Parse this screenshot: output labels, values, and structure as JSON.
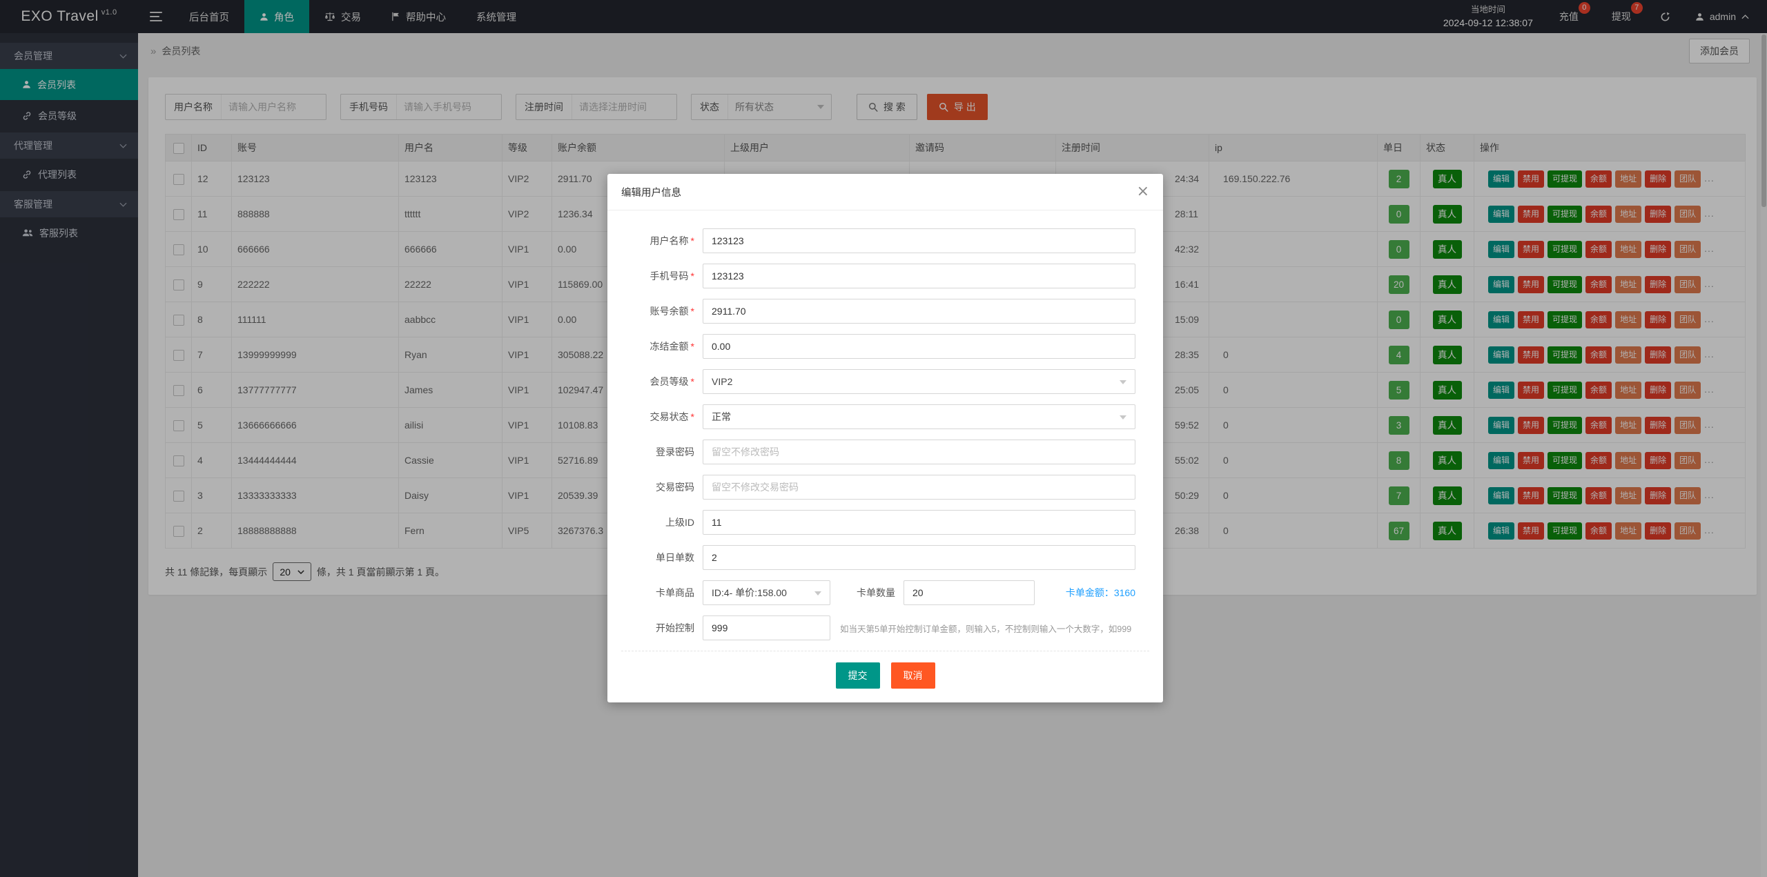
{
  "navbar": {
    "logo": "EXO Travel",
    "logo_version": "v1.0",
    "menu": [
      {
        "key": "home",
        "label": "后台首页",
        "icon": "",
        "active": false
      },
      {
        "key": "roles",
        "label": "角色",
        "icon": "person-icon",
        "active": true
      },
      {
        "key": "trade",
        "label": "交易",
        "icon": "scales-icon",
        "active": false
      },
      {
        "key": "help",
        "label": "帮助中心",
        "icon": "flag-icon",
        "active": false
      },
      {
        "key": "system",
        "label": "系统管理",
        "icon": "",
        "active": false
      }
    ],
    "time_label": "当地时间",
    "time_value": "2024-09-12 12:38:07",
    "recharge": {
      "label": "充值",
      "badge": "0"
    },
    "withdraw": {
      "label": "提现",
      "badge": "7"
    },
    "user": "admin"
  },
  "sidebar": [
    {
      "type": "section",
      "key": "member-mgmt",
      "label": "会员管理"
    },
    {
      "type": "item",
      "key": "member-list",
      "label": "会员列表",
      "icon": "person-icon",
      "active": true
    },
    {
      "type": "item",
      "key": "member-level",
      "label": "会员等级",
      "icon": "link-icon",
      "active": false
    },
    {
      "type": "section",
      "key": "agent-mgmt",
      "label": "代理管理"
    },
    {
      "type": "item",
      "key": "agent-list",
      "label": "代理列表",
      "icon": "link-icon",
      "active": false
    },
    {
      "type": "section",
      "key": "service-mgmt",
      "label": "客服管理"
    },
    {
      "type": "item",
      "key": "service-list",
      "label": "客服列表",
      "icon": "users-icon",
      "active": false
    }
  ],
  "breadcrumb": {
    "sep": "»",
    "label": "会员列表"
  },
  "add_member_label": "添加会员",
  "filters": {
    "username": {
      "label": "用户名称",
      "placeholder": "请输入用户名称"
    },
    "phone": {
      "label": "手机号码",
      "placeholder": "请输入手机号码"
    },
    "reg_time": {
      "label": "注册时间",
      "placeholder": "请选择注册时间"
    },
    "status": {
      "label": "状态",
      "value": "所有状态"
    },
    "search_label": "搜 索",
    "export_label": "导 出"
  },
  "table": {
    "headers": [
      "ID",
      "账号",
      "用户名",
      "等级",
      "账户余额",
      "上级用户",
      "邀请码",
      "注册时间",
      "ip",
      "单日",
      "状态",
      "操作"
    ],
    "status_label": "真人",
    "more_label": "...",
    "actions": [
      {
        "key": "edit",
        "label": "编辑",
        "style": "teal"
      },
      {
        "key": "disable",
        "label": "禁用",
        "style": "red"
      },
      {
        "key": "withdrawable",
        "label": "可提现",
        "style": "green"
      },
      {
        "key": "balance",
        "label": "余额",
        "style": "red"
      },
      {
        "key": "address",
        "label": "地址",
        "style": "orange"
      },
      {
        "key": "delete",
        "label": "删除",
        "style": "red"
      },
      {
        "key": "team",
        "label": "团队",
        "style": "orange"
      }
    ],
    "rows": [
      {
        "id": "12",
        "account": "123123",
        "username": "123123",
        "level": "VIP2",
        "balance": "2911.70",
        "parent": "",
        "invite": "",
        "reg_time": "24:34",
        "ip": "169.150.222.76",
        "daily": "2"
      },
      {
        "id": "11",
        "account": "888888",
        "username": "tttttt",
        "level": "VIP2",
        "balance": "1236.34",
        "parent": "",
        "invite": "",
        "reg_time": "28:11",
        "ip": "",
        "daily": "0"
      },
      {
        "id": "10",
        "account": "666666",
        "username": "666666",
        "level": "VIP1",
        "balance": "0.00",
        "parent": "",
        "invite": "",
        "reg_time": "42:32",
        "ip": "",
        "daily": "0"
      },
      {
        "id": "9",
        "account": "222222",
        "username": "22222",
        "level": "VIP1",
        "balance": "115869.00",
        "parent": "",
        "invite": "",
        "reg_time": "16:41",
        "ip": "",
        "daily": "20"
      },
      {
        "id": "8",
        "account": "111111",
        "username": "aabbcc",
        "level": "VIP1",
        "balance": "0.00",
        "parent": "",
        "invite": "",
        "reg_time": "15:09",
        "ip": "",
        "daily": "0"
      },
      {
        "id": "7",
        "account": "13999999999",
        "username": "Ryan",
        "level": "VIP1",
        "balance": "305088.22",
        "parent": "",
        "invite": "",
        "reg_time": "28:35",
        "ip": "0",
        "daily": "4"
      },
      {
        "id": "6",
        "account": "13777777777",
        "username": "James",
        "level": "VIP1",
        "balance": "102947.47",
        "parent": "",
        "invite": "",
        "reg_time": "25:05",
        "ip": "0",
        "daily": "5"
      },
      {
        "id": "5",
        "account": "13666666666",
        "username": "ailisi",
        "level": "VIP1",
        "balance": "10108.83",
        "parent": "",
        "invite": "",
        "reg_time": "59:52",
        "ip": "0",
        "daily": "3"
      },
      {
        "id": "4",
        "account": "13444444444",
        "username": "Cassie",
        "level": "VIP1",
        "balance": "52716.89",
        "parent": "",
        "invite": "",
        "reg_time": "55:02",
        "ip": "0",
        "daily": "8"
      },
      {
        "id": "3",
        "account": "13333333333",
        "username": "Daisy",
        "level": "VIP1",
        "balance": "20539.39",
        "parent": "",
        "invite": "",
        "reg_time": "50:29",
        "ip": "0",
        "daily": "7"
      },
      {
        "id": "2",
        "account": "18888888888",
        "username": "Fern",
        "level": "VIP5",
        "balance": "3267376.3",
        "parent": "",
        "invite": "",
        "reg_time": "26:38",
        "ip": "0",
        "daily": "67"
      }
    ]
  },
  "pagination": {
    "text_before": "共 11 條記錄，每頁顯示",
    "page_size": "20",
    "text_after": "條，共 1 頁當前顯示第 1 頁。"
  },
  "modal": {
    "title": "编辑用户信息",
    "close": "×",
    "fields": [
      {
        "key": "username",
        "label": "用户名称",
        "required": true,
        "type": "input",
        "value": "123123",
        "placeholder": ""
      },
      {
        "key": "phone",
        "label": "手机号码",
        "required": true,
        "type": "input",
        "value": "123123",
        "placeholder": ""
      },
      {
        "key": "balance",
        "label": "账号余额",
        "required": true,
        "type": "input",
        "value": "2911.70",
        "placeholder": ""
      },
      {
        "key": "frozen",
        "label": "冻结金额",
        "required": true,
        "type": "input",
        "value": "0.00",
        "placeholder": ""
      },
      {
        "key": "level",
        "label": "会员等级",
        "required": true,
        "type": "select",
        "value": "VIP2"
      },
      {
        "key": "trade-status",
        "label": "交易状态",
        "required": true,
        "type": "select",
        "value": "正常"
      },
      {
        "key": "login-password",
        "label": "登录密码",
        "required": false,
        "type": "input",
        "value": "",
        "placeholder": "留空不修改密码"
      },
      {
        "key": "trade-password",
        "label": "交易密码",
        "required": false,
        "type": "input",
        "value": "",
        "placeholder": "留空不修改交易密码"
      },
      {
        "key": "parent-id",
        "label": "上级ID",
        "required": false,
        "type": "input",
        "value": "11",
        "placeholder": ""
      },
      {
        "key": "daily-orders",
        "label": "单日单数",
        "required": false,
        "type": "input",
        "value": "2",
        "placeholder": ""
      }
    ],
    "card_row": {
      "product_label": "卡单商品",
      "product_value": "ID:4- 单价:158.00",
      "qty_label": "卡单数量",
      "qty_value": "20",
      "amount_text": "卡单金额：3160"
    },
    "control_row": {
      "label": "开始控制",
      "value": "999",
      "hint": "如当天第5单开始控制订单金额，则输入5，不控制则输入一个大数字，如999"
    },
    "submit_label": "提交",
    "cancel_label": "取消"
  },
  "colors": {
    "accent_teal": "#009688",
    "accent_red": "#e23c28",
    "accent_green": "#0e8a0e",
    "accent_orange": "#e07a4e",
    "export_orange": "#e6532a",
    "cancel_orange": "#ff5722",
    "link_blue": "#1E9FFF",
    "badge_red": "#f0442e"
  }
}
